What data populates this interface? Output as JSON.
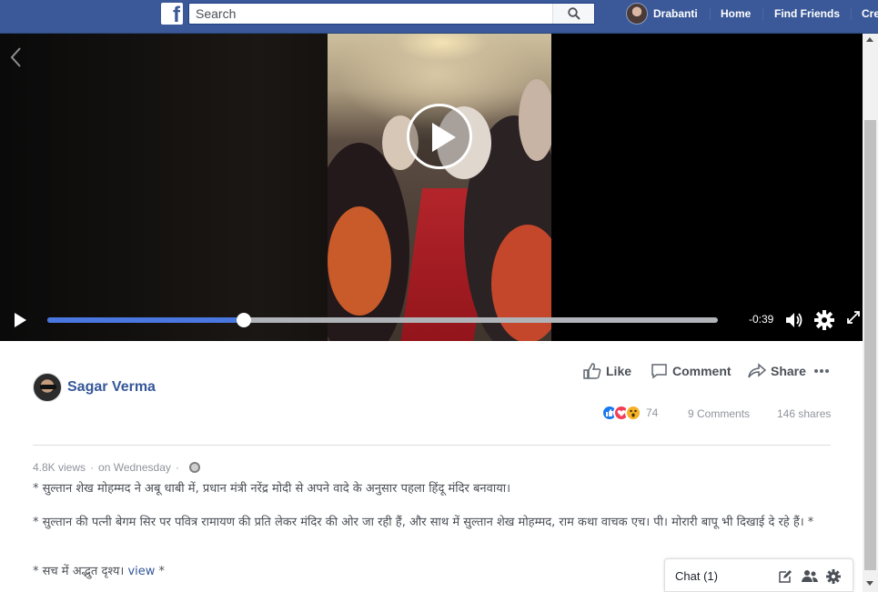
{
  "topbar": {
    "logo_letter": "f",
    "search_placeholder": "Search",
    "user_name": "Drabanti",
    "nav": [
      "Home",
      "Find Friends",
      "Cre"
    ]
  },
  "video": {
    "time_remaining": "-0:39",
    "progress_fraction": 0.293
  },
  "post": {
    "author": "Sagar Verma",
    "actions": {
      "like": "Like",
      "comment": "Comment",
      "share": "Share"
    },
    "reaction_count": "74",
    "comments": "9 Comments",
    "shares": "146 shares",
    "views": "4.8K views",
    "dot": "·",
    "posted": "on Wednesday",
    "paragraphs": [
      "* सुल्तान शेख मोहम्मद ने अबू धाबी में, प्रधान मंत्री नरेंद्र मोदी से अपने वादे के अनुसार पहला हिंदू मंदिर बनवाया।",
      "* सुल्तान की पत्नी बेगम सिर पर पवित्र रामायण की प्रति लेकर मंदिर की ओर जा रही हैं, और साथ में सुल्तान शेख मोहम्मद, राम कथा वाचक एच। पी। मोरारी बापू भी दिखाई दे रहे हैं। *"
    ],
    "last_paragraph_prefix": "* सच में अद्भुत दृश्य। ",
    "view_link": "view",
    "last_paragraph_suffix": " *"
  },
  "chat": {
    "label": "Chat (1)"
  },
  "colors": {
    "topbar": "#3b5998",
    "link": "#365899",
    "progress": "#4a76e0",
    "secondary_text": "#90949c"
  }
}
